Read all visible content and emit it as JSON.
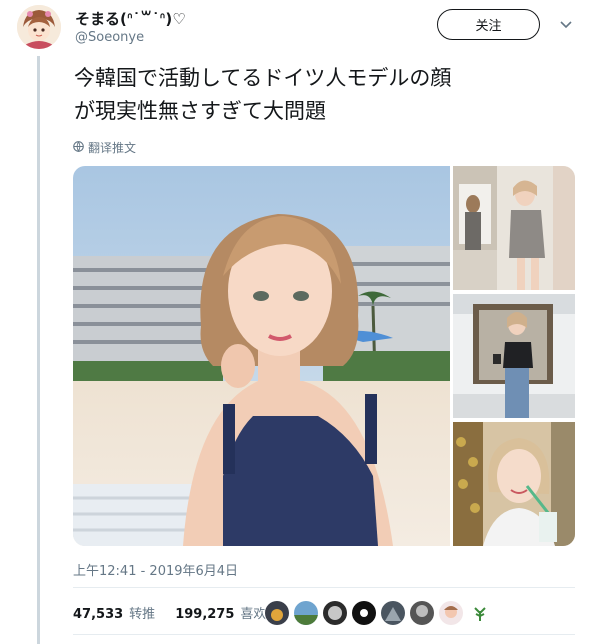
{
  "tweet": {
    "display_name": "そまる(ᐢ˙꒳​˙ᐢ)♡",
    "handle": "@Soeonye",
    "follow_label": "关注",
    "text_line1": "今韓国で活動してるドイツ人モデルの顔",
    "text_line2": "が現実性無さすぎて大問題",
    "translate_label": "翻译推文",
    "timestamp": "上午12:41 - 2019年6月4日"
  },
  "stats": {
    "retweets": "47,533",
    "retweets_label": "转推",
    "likes": "199,275",
    "likes_label": "喜欢"
  },
  "icons": {
    "globe": "globe-icon",
    "caret": "chevron-down-icon"
  }
}
